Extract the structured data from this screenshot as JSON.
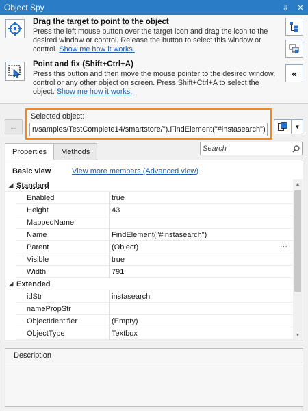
{
  "window": {
    "title": "Object Spy",
    "pin_glyph": "⇩",
    "close_glyph": "✕"
  },
  "tools": {
    "drag": {
      "heading": "Drag the target to point to the object",
      "description": "Press the left mouse button over the target icon and drag the icon to the desired window or control. Release the button to select this window or control.",
      "link": "Show me how it works."
    },
    "point": {
      "heading": "Point and fix (Shift+Ctrl+A)",
      "description": "Press this button and then move the mouse pointer to the desired window, control or any other object on screen. Press Shift+Ctrl+A to select the object.",
      "link": "Show me how it works."
    }
  },
  "side": {
    "collapse_glyph": "«"
  },
  "selected": {
    "label": "Selected object:",
    "value": "n/samples/TestComplete14/smartstore/\").FindElement(\"#instasearch\")",
    "back_glyph": "←",
    "drop_glyph": "▼"
  },
  "tabs": [
    {
      "label": "Properties",
      "active": true
    },
    {
      "label": "Methods",
      "active": false
    }
  ],
  "search": {
    "placeholder": "Search"
  },
  "view": {
    "basic": "Basic view",
    "advanced_link": "View more members (Advanced view)"
  },
  "categories": {
    "standard": {
      "label": "Standard",
      "toggle": "◢",
      "rows": [
        {
          "name": "Enabled",
          "value": "true"
        },
        {
          "name": "Height",
          "value": "43"
        },
        {
          "name": "MappedName",
          "value": ""
        },
        {
          "name": "Name",
          "value": "FindElement(\"#instasearch\")"
        },
        {
          "name": "Parent",
          "value": "(Object)",
          "extra": "···"
        },
        {
          "name": "Visible",
          "value": "true"
        },
        {
          "name": "Width",
          "value": "791"
        }
      ]
    },
    "extended": {
      "label": "Extended",
      "toggle": "◢",
      "rows": [
        {
          "name": "idStr",
          "value": "instasearch"
        },
        {
          "name": "namePropStr",
          "value": ""
        },
        {
          "name": "ObjectIdentifier",
          "value": "(Empty)"
        },
        {
          "name": "ObjectType",
          "value": "Textbox"
        }
      ]
    }
  },
  "scroll": {
    "up_glyph": "▲",
    "down_glyph": "▼"
  },
  "description": {
    "label": "Description"
  },
  "colors": {
    "titlebar": "#2b7cc6",
    "highlight_border": "#f08a1c",
    "link": "#1a5fb4"
  }
}
